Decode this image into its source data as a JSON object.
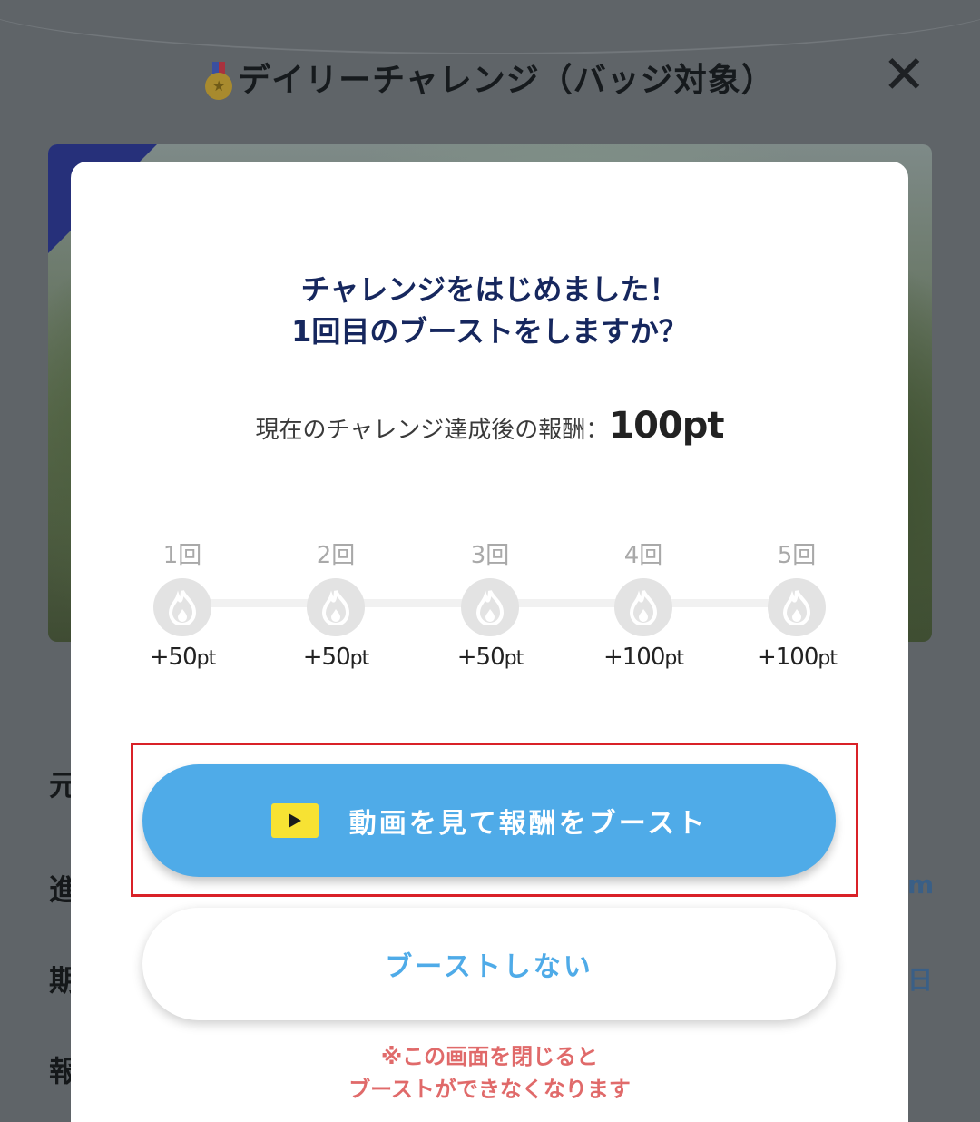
{
  "background": {
    "header_title": "デイリーチャレンジ（バッジ対象）",
    "close_icon": "close-icon",
    "medal_icon": "medal-icon",
    "labels": [
      "元",
      "進",
      "期",
      "報"
    ],
    "right_values": [
      "m",
      "日"
    ]
  },
  "modal": {
    "title_line1": "チャレンジをはじめました！",
    "title_line2": "1回目のブーストをしますか？",
    "reward_label": "現在のチャレンジ達成後の報酬：",
    "reward_value": "100pt",
    "boost_steps": [
      {
        "count": "1回",
        "points": "+50",
        "unit": "pt"
      },
      {
        "count": "2回",
        "points": "+50",
        "unit": "pt"
      },
      {
        "count": "3回",
        "points": "+50",
        "unit": "pt"
      },
      {
        "count": "4回",
        "points": "+100",
        "unit": "pt"
      },
      {
        "count": "5回",
        "points": "+100",
        "unit": "pt"
      }
    ],
    "boost_button_label": "動画を見て報酬をブースト",
    "no_boost_button_label": "ブーストしない",
    "warning_line1": "※この画面を閉じると",
    "warning_line2": "ブーストができなくなります"
  },
  "colors": {
    "accent_blue": "#4fabe8",
    "title_navy": "#16275e",
    "warning_red": "#e06a6a",
    "highlight_red": "#d92128",
    "play_yellow": "#f7e233"
  }
}
